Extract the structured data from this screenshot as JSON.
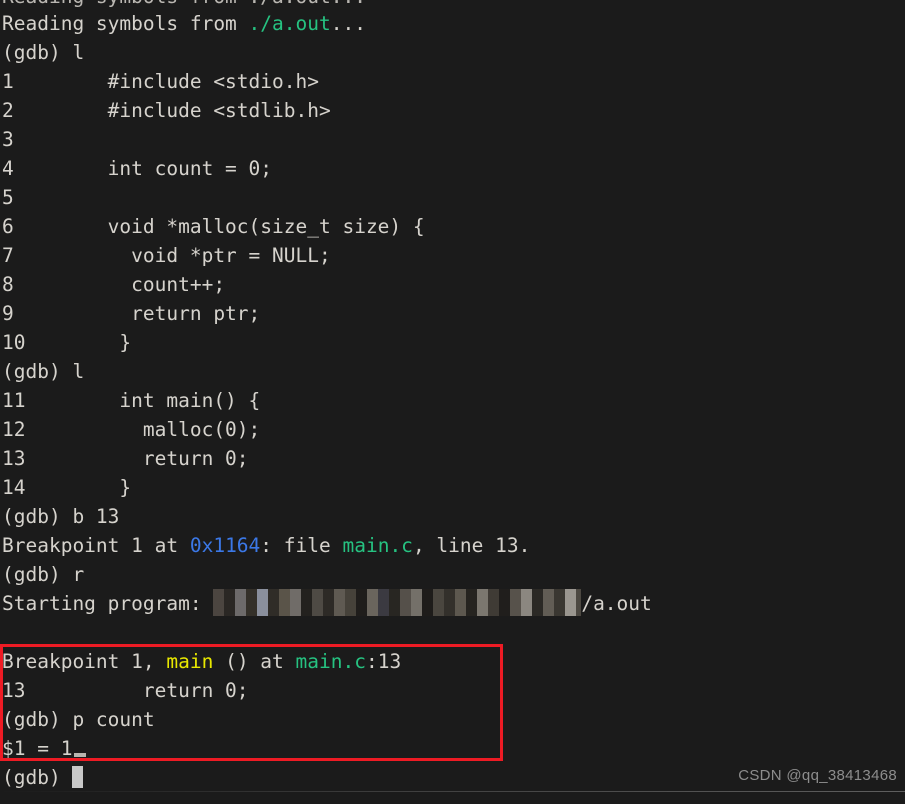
{
  "terminal": {
    "background_color": "#1b1b1b",
    "foreground_color": "#d6d3cd",
    "colors": {
      "green": "#26c281",
      "blue": "#3b78e7",
      "yellow": "#e8e800",
      "highlight_red": "#ee1b24",
      "cursor": "#c8c8c8"
    },
    "clipped_top_line": "Reading symbols from ./a.out...",
    "lines": [
      {
        "id": "reading-symbols",
        "segments": [
          {
            "text": "Reading symbols from ",
            "color": "default"
          },
          {
            "text": "./a.out",
            "color": "green"
          },
          {
            "text": "...",
            "color": "default"
          }
        ]
      },
      {
        "id": "prompt-list-1",
        "segments": [
          {
            "text": "(gdb) l",
            "color": "default"
          }
        ]
      },
      {
        "id": "src-1",
        "segments": [
          {
            "text": "1\t#include <stdio.h>",
            "color": "default"
          }
        ]
      },
      {
        "id": "src-2",
        "segments": [
          {
            "text": "2\t#include <stdlib.h>",
            "color": "default"
          }
        ]
      },
      {
        "id": "src-3",
        "segments": [
          {
            "text": "3",
            "color": "default"
          }
        ]
      },
      {
        "id": "src-4",
        "segments": [
          {
            "text": "4\tint count = 0;",
            "color": "default"
          }
        ]
      },
      {
        "id": "src-5",
        "segments": [
          {
            "text": "5",
            "color": "default"
          }
        ]
      },
      {
        "id": "src-6",
        "segments": [
          {
            "text": "6\tvoid *malloc(size_t size) {",
            "color": "default"
          }
        ]
      },
      {
        "id": "src-7",
        "segments": [
          {
            "text": "7\t  void *ptr = NULL;",
            "color": "default"
          }
        ]
      },
      {
        "id": "src-8",
        "segments": [
          {
            "text": "8\t  count++;",
            "color": "default"
          }
        ]
      },
      {
        "id": "src-9",
        "segments": [
          {
            "text": "9\t  return ptr;",
            "color": "default"
          }
        ]
      },
      {
        "id": "src-10",
        "segments": [
          {
            "text": "10\t}",
            "color": "default"
          }
        ]
      },
      {
        "id": "prompt-list-2",
        "segments": [
          {
            "text": "(gdb) l",
            "color": "default"
          }
        ]
      },
      {
        "id": "src-11",
        "segments": [
          {
            "text": "11\tint main() {",
            "color": "default"
          }
        ]
      },
      {
        "id": "src-12",
        "segments": [
          {
            "text": "12\t  malloc(0);",
            "color": "default"
          }
        ]
      },
      {
        "id": "src-13",
        "segments": [
          {
            "text": "13\t  return 0;",
            "color": "default"
          }
        ]
      },
      {
        "id": "src-14",
        "segments": [
          {
            "text": "14\t}",
            "color": "default"
          }
        ]
      },
      {
        "id": "prompt-break",
        "segments": [
          {
            "text": "(gdb) b 13",
            "color": "default"
          }
        ]
      },
      {
        "id": "breakpoint-set",
        "segments": [
          {
            "text": "Breakpoint 1 at ",
            "color": "default"
          },
          {
            "text": "0x1164",
            "color": "blue"
          },
          {
            "text": ": file ",
            "color": "default"
          },
          {
            "text": "main.c",
            "color": "green"
          },
          {
            "text": ", line 13.",
            "color": "default"
          }
        ]
      },
      {
        "id": "prompt-run",
        "segments": [
          {
            "text": "(gdb) r",
            "color": "default"
          }
        ]
      },
      {
        "id": "starting-program",
        "segments": [
          {
            "text": "Starting program: ",
            "color": "default"
          },
          {
            "text": "",
            "redacted": true
          },
          {
            "text": "/a.out",
            "color": "default"
          }
        ]
      },
      {
        "id": "blank-1",
        "segments": [
          {
            "text": "",
            "color": "default"
          }
        ]
      },
      {
        "id": "breakpoint-hit",
        "segments": [
          {
            "text": "Breakpoint 1, ",
            "color": "default"
          },
          {
            "text": "main",
            "color": "yellow"
          },
          {
            "text": " () at ",
            "color": "default"
          },
          {
            "text": "main.c",
            "color": "green"
          },
          {
            "text": ":13",
            "color": "default"
          }
        ]
      },
      {
        "id": "stopped-line",
        "segments": [
          {
            "text": "13\t  return 0;",
            "color": "default"
          }
        ]
      },
      {
        "id": "prompt-print",
        "segments": [
          {
            "text": "(gdb) p count",
            "color": "default"
          }
        ]
      },
      {
        "id": "print-result",
        "segments": [
          {
            "text": "$1 = 1",
            "color": "default"
          },
          {
            "cursor": "underscore"
          }
        ]
      },
      {
        "id": "prompt-final",
        "segments": [
          {
            "text": "(gdb) ",
            "color": "default"
          },
          {
            "cursor": "block"
          }
        ]
      }
    ]
  },
  "highlight_box": {
    "label": "red-annotation-rectangle",
    "color": "#ee1b24",
    "encloses": "Breakpoint 1, main () at main.c:13 through $1 = 1"
  },
  "watermark": {
    "text": "CSDN @qq_38413468"
  }
}
